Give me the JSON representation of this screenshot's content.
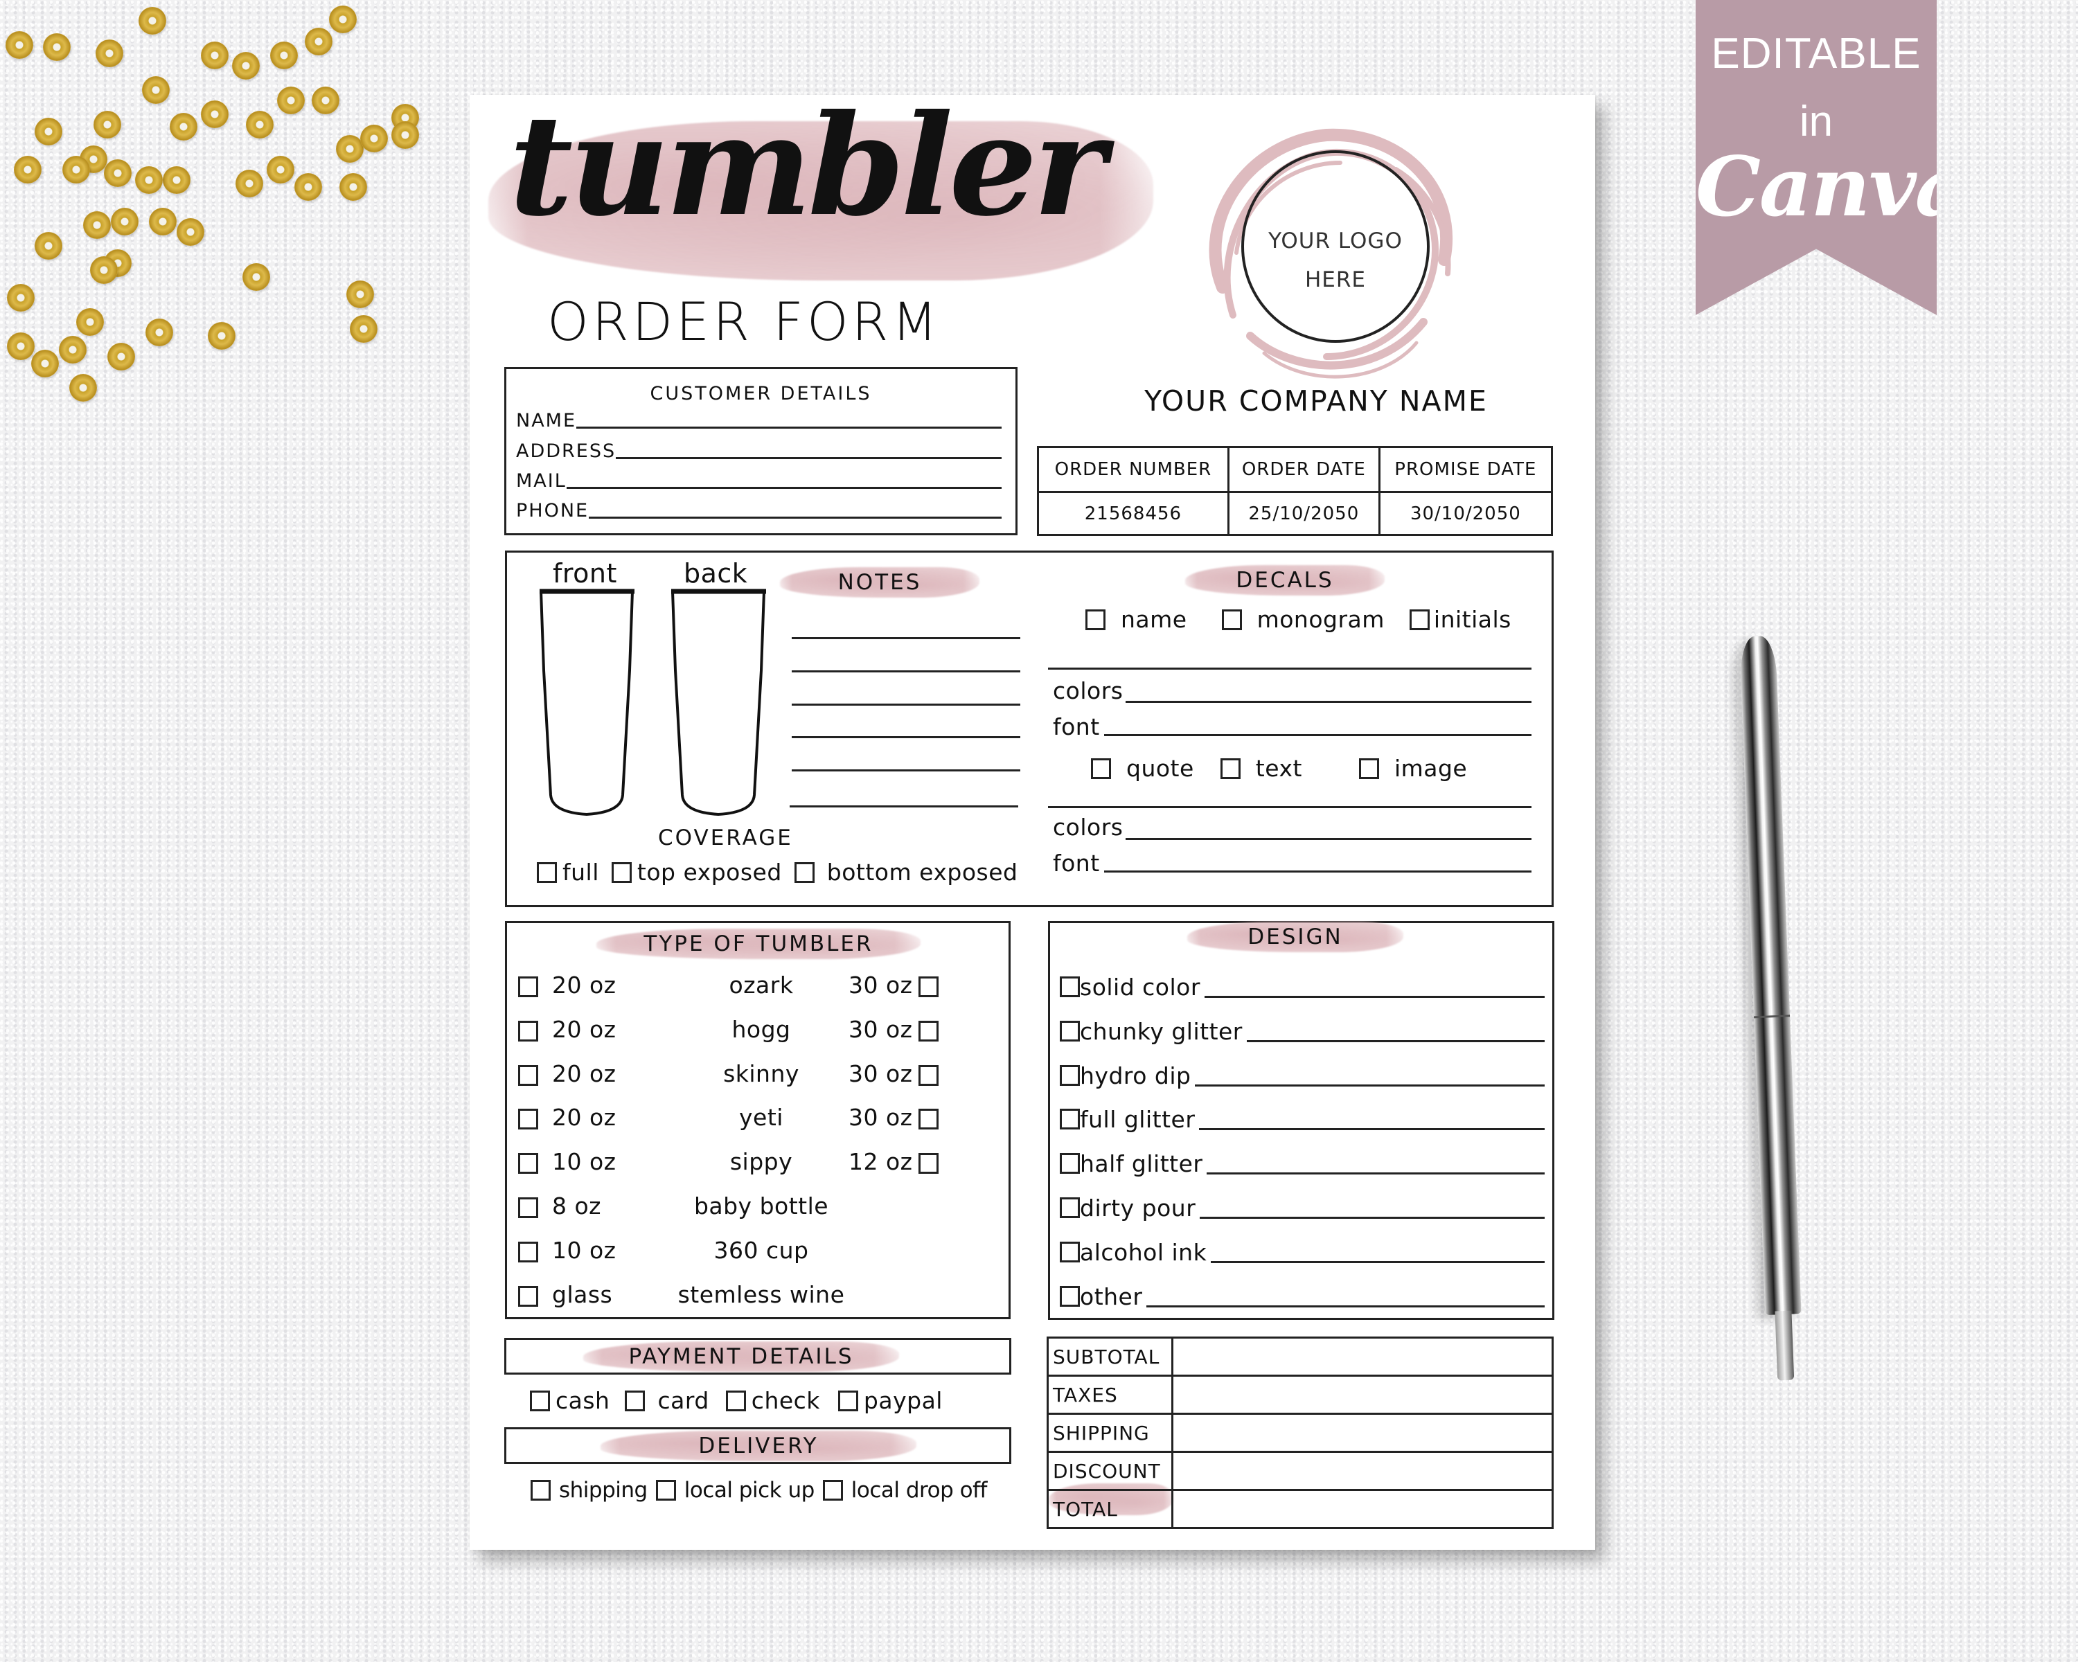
{
  "banner": {
    "line1": "EDITABLE",
    "line2": "in",
    "line3": "Canva",
    "color": "#b89ba6"
  },
  "form": {
    "script_title": "tumbler",
    "title": "ORDER FORM",
    "accent_color": "#e2c0c4",
    "logo": {
      "line1": "YOUR LOGO",
      "line2": "HERE"
    },
    "company_name": "YOUR COMPANY NAME",
    "customer_details": {
      "title": "CUSTOMER DETAILS",
      "fields": [
        {
          "label": "NAME",
          "value": ""
        },
        {
          "label": "ADDRESS",
          "value": ""
        },
        {
          "label": "MAIL",
          "value": ""
        },
        {
          "label": "PHONE",
          "value": ""
        }
      ]
    },
    "order_table": {
      "headers": [
        "ORDER NUMBER",
        "ORDER DATE",
        "PROMISE DATE"
      ],
      "values": [
        "21568456",
        "25/10/2050",
        "30/10/2050"
      ]
    },
    "views": {
      "front": "front",
      "back": "back"
    },
    "notes": {
      "title": "NOTES"
    },
    "coverage": {
      "title": "COVERAGE",
      "options": [
        "full",
        "top exposed",
        "bottom exposed"
      ]
    },
    "decals": {
      "title": "DECALS",
      "options_row1": [
        "name",
        "monogram",
        "initials"
      ],
      "options_row2": [
        "quote",
        "text",
        "image"
      ],
      "colors_label": "colors",
      "font_label": "font"
    },
    "tumbler_types": {
      "title": "TYPE OF TUMBLER",
      "rows": [
        {
          "left": "20 oz",
          "name": "ozark",
          "right": "30 oz"
        },
        {
          "left": "20 oz",
          "name": "hogg",
          "right": "30 oz"
        },
        {
          "left": "20 oz",
          "name": "skinny",
          "right": "30 oz"
        },
        {
          "left": "20 oz",
          "name": "yeti",
          "right": "30 oz"
        },
        {
          "left": "10 oz",
          "name": "sippy",
          "right": "12 oz"
        },
        {
          "left": "8 oz",
          "name": "baby bottle",
          "right": null
        },
        {
          "left": "10 oz",
          "name": "360 cup",
          "right": null
        },
        {
          "left": "glass",
          "name": "stemless wine",
          "right": null
        }
      ]
    },
    "design": {
      "title": "DESIGN",
      "options": [
        "solid color",
        "chunky glitter",
        "hydro dip",
        "full glitter",
        "half glitter",
        "dirty pour",
        "alcohol ink",
        "other"
      ]
    },
    "payment": {
      "title": "PAYMENT DETAILS",
      "options": [
        "cash",
        "card",
        "check",
        "paypal"
      ]
    },
    "delivery": {
      "title": "DELIVERY",
      "options": [
        "shipping",
        "local pick up",
        "local drop off"
      ]
    },
    "totals": {
      "rows": [
        {
          "label": "SUBTOTAL",
          "value": ""
        },
        {
          "label": "TAXES",
          "value": ""
        },
        {
          "label": "SHIPPING",
          "value": ""
        },
        {
          "label": "DISCOUNT",
          "value": ""
        },
        {
          "label": "TOTAL",
          "value": ""
        }
      ]
    }
  }
}
